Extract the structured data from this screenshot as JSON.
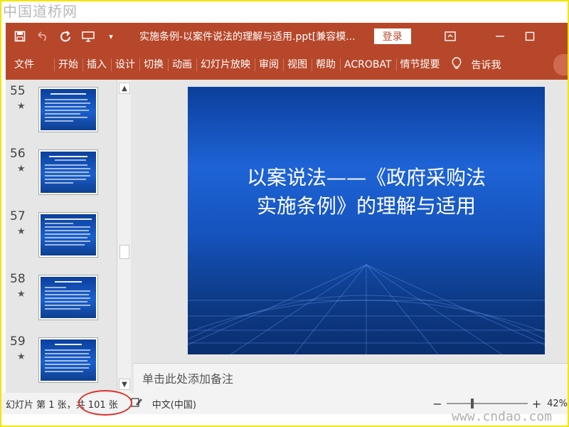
{
  "watermark": {
    "top": "中国道桥网",
    "bottom": "www.cndao.com"
  },
  "titlebar": {
    "document_title": "实施条例-以案件说法的理解与适用.ppt[兼容模...",
    "login_label": "登录"
  },
  "ribbon": {
    "tabs": [
      "文件",
      "开始",
      "插入",
      "设计",
      "切换",
      "动画",
      "幻灯片放映",
      "审阅",
      "视图",
      "帮助",
      "ACROBAT",
      "情节提要"
    ],
    "tell_me": "告诉我"
  },
  "thumbnails": [
    {
      "number": "55",
      "star": "★"
    },
    {
      "number": "56",
      "star": "★"
    },
    {
      "number": "57",
      "star": "★"
    },
    {
      "number": "58",
      "star": "★"
    },
    {
      "number": "59",
      "star": "★"
    }
  ],
  "slide": {
    "title_line1": "以案说法——《政府采购法",
    "title_line2": "实施条例》的理解与适用"
  },
  "notes": {
    "placeholder": "单击此处添加备注"
  },
  "statusbar": {
    "slide_count": "幻灯片 第 1 张，共 101 张",
    "language": "中文(中国)",
    "zoom_minus": "−",
    "zoom_plus": "+",
    "zoom_value": "42%",
    "zoom_fraction": 0.3
  },
  "colors": {
    "accent": "#b7472a",
    "annotation": "#d9342b",
    "frame": "#f2e600"
  }
}
